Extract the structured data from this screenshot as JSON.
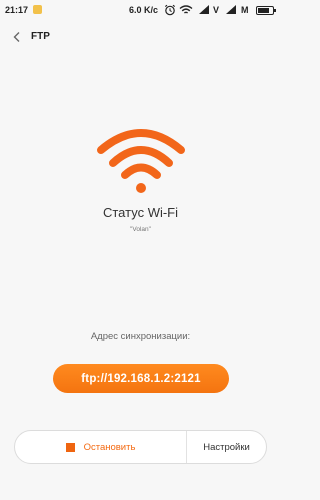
{
  "status_bar": {
    "time": "21:17",
    "speed": "6.0 K/c",
    "carrier1": "V",
    "carrier2": "M",
    "battery_level": 0.85,
    "icons": [
      "notification-icon",
      "alarm-icon",
      "wifi-icon",
      "signal-icon",
      "signal-icon",
      "battery-icon"
    ]
  },
  "header": {
    "title": "FTP",
    "back_icon": "chevron-left-icon"
  },
  "main": {
    "status_icon": "wifi-icon",
    "status_title": "Статус Wi-Fi",
    "ssid": "\"Volan\"",
    "sync_label": "Адрес синхронизации:",
    "address": "ftp://192.168.1.2:2121"
  },
  "actions": {
    "stop_label": "Остановить",
    "settings_label": "Настройки"
  },
  "colors": {
    "accent": "#f47410",
    "background": "#f7f7f7"
  }
}
